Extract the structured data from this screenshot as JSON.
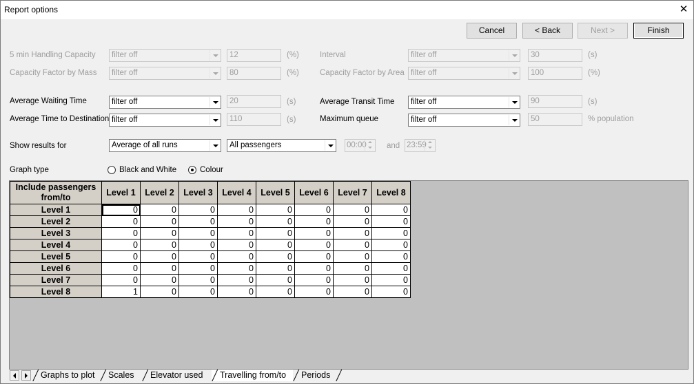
{
  "window": {
    "title": "Report options"
  },
  "buttons": {
    "cancel": "Cancel",
    "back": "< Back",
    "next": "Next >",
    "finish": "Finish"
  },
  "filters": {
    "handling_capacity": {
      "label": "5 min Handling Capacity",
      "value": "filter off",
      "number": "12",
      "unit": "(%)"
    },
    "capacity_mass": {
      "label": "Capacity Factor by Mass",
      "value": "filter off",
      "number": "80",
      "unit": "(%)"
    },
    "interval": {
      "label": "Interval",
      "value": "filter off",
      "number": "30",
      "unit": "(s)"
    },
    "capacity_area": {
      "label": "Capacity Factor by Area",
      "value": "filter off",
      "number": "100",
      "unit": "(%)"
    },
    "avg_waiting": {
      "label": "Average Waiting Time",
      "value": "filter off",
      "number": "20",
      "unit": "(s)"
    },
    "avg_destination": {
      "label": "Average Time to Destination",
      "value": "filter off",
      "number": "110",
      "unit": "(s)"
    },
    "avg_transit": {
      "label": "Average Transit Time",
      "value": "filter off",
      "number": "90",
      "unit": "(s)"
    },
    "max_queue": {
      "label": "Maximum queue",
      "value": "filter off",
      "number": "50",
      "unit": "% population"
    }
  },
  "results": {
    "label": "Show results for",
    "runs": "Average of all runs",
    "passengers": "All passengers",
    "time_from": "00:00",
    "and": "and",
    "time_to": "23:59"
  },
  "graph": {
    "label": "Graph type",
    "option_bw": "Black and White",
    "option_colour": "Colour",
    "selected": "Colour"
  },
  "grid": {
    "corner": "Include passengers from/to",
    "columns": [
      "Level 1",
      "Level 2",
      "Level 3",
      "Level 4",
      "Level 5",
      "Level 6",
      "Level 7",
      "Level 8"
    ],
    "rows": [
      {
        "label": "Level 1",
        "values": [
          "0",
          "0",
          "0",
          "0",
          "0",
          "0",
          "0",
          "0"
        ]
      },
      {
        "label": "Level 2",
        "values": [
          "0",
          "0",
          "0",
          "0",
          "0",
          "0",
          "0",
          "0"
        ]
      },
      {
        "label": "Level 3",
        "values": [
          "0",
          "0",
          "0",
          "0",
          "0",
          "0",
          "0",
          "0"
        ]
      },
      {
        "label": "Level 4",
        "values": [
          "0",
          "0",
          "0",
          "0",
          "0",
          "0",
          "0",
          "0"
        ]
      },
      {
        "label": "Level 5",
        "values": [
          "0",
          "0",
          "0",
          "0",
          "0",
          "0",
          "0",
          "0"
        ]
      },
      {
        "label": "Level 6",
        "values": [
          "0",
          "0",
          "0",
          "0",
          "0",
          "0",
          "0",
          "0"
        ]
      },
      {
        "label": "Level 7",
        "values": [
          "0",
          "0",
          "0",
          "0",
          "0",
          "0",
          "0",
          "0"
        ]
      },
      {
        "label": "Level 8",
        "values": [
          "1",
          "0",
          "0",
          "0",
          "0",
          "0",
          "0",
          "0"
        ]
      }
    ]
  },
  "tabs": [
    "Graphs to plot",
    "Scales",
    "Elevator used",
    "Travelling from/to",
    "Periods"
  ],
  "active_tab": "Travelling from/to"
}
